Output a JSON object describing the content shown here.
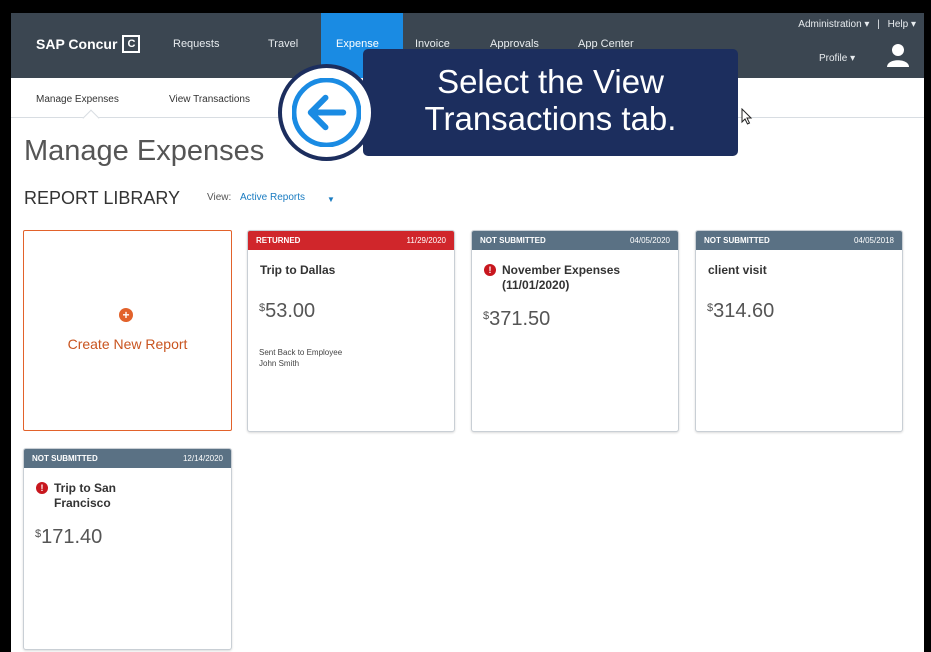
{
  "brand": {
    "name": "SAP Concur",
    "mark": "C"
  },
  "topnav": {
    "items": [
      {
        "label": "Requests"
      },
      {
        "label": "Travel"
      },
      {
        "label": "Expense"
      },
      {
        "label": "Invoice"
      },
      {
        "label": "Approvals"
      },
      {
        "label": "App Center"
      }
    ],
    "active": "Expense",
    "administration": "Administration ▾",
    "separator": "|",
    "help": "Help ▾",
    "profile": "Profile ▾"
  },
  "subnav": {
    "items": [
      {
        "label": "Manage Expenses"
      },
      {
        "label": "View Transactions"
      }
    ]
  },
  "page": {
    "title": "Manage Expenses",
    "library_title": "REPORT LIBRARY",
    "view_label": "View:",
    "view_value": "Active Reports"
  },
  "create_card": {
    "label": "Create New Report",
    "icon": "plus-circle-icon"
  },
  "reports": [
    {
      "status": "RETURNED",
      "date": "11/29/2020",
      "name": "Trip to Dallas",
      "currency": "$",
      "amount": "53.00",
      "alert": false,
      "note_line1": "Sent Back to Employee",
      "note_line2": "John Smith",
      "header_color": "#d0262b"
    },
    {
      "status": "NOT SUBMITTED",
      "date": "04/05/2020",
      "name": "November Expenses (11/01/2020)",
      "currency": "$",
      "amount": "371.50",
      "alert": true,
      "header_color": "#5a7184"
    },
    {
      "status": "NOT SUBMITTED",
      "date": "04/05/2018",
      "name": "client visit",
      "currency": "$",
      "amount": "314.60",
      "alert": false,
      "header_color": "#5a7184"
    },
    {
      "status": "NOT SUBMITTED",
      "date": "12/14/2020",
      "name": "Trip to San Francisco",
      "currency": "$",
      "amount": "171.40",
      "alert": true,
      "header_color": "#5a7184"
    }
  ],
  "callout": {
    "line1": "Select the View",
    "line2": "Transactions tab."
  },
  "colors": {
    "nav_bg": "#3b4651",
    "nav_active": "#1a8be3",
    "accent_orange": "#e2622b",
    "callout_bg": "#1c2e5e"
  }
}
